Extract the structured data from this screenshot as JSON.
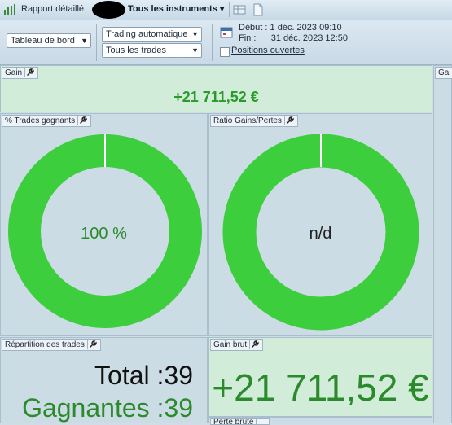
{
  "titlebar": {
    "title": "Rapport détaillé",
    "instruments": "Tous les instruments ▾"
  },
  "toolbar": {
    "view_select": "Tableau de bord",
    "trading_select": "Trading automatique",
    "trades_select": "Tous les trades",
    "debut_label": "Début :",
    "debut_value": "1 déc. 2023 09:10",
    "fin_label": "Fin :",
    "fin_value": "31 déc. 2023 12:50",
    "positions_label": "Positions ouvertes"
  },
  "panels": {
    "gain": {
      "title": "Gain",
      "value": "+21 711,52 €"
    },
    "gain_right": {
      "title": "Gai"
    },
    "pct_winning": {
      "title": "% Trades gagnants",
      "value": "100 %"
    },
    "ratio": {
      "title": "Ratio Gains/Pertes",
      "value": "n/d"
    },
    "repartition": {
      "title": "Répartition des trades",
      "total_label": "Total :",
      "total_value": "39",
      "winning_label": "Gagnantes :",
      "winning_value": "39"
    },
    "gain_brut": {
      "title": "Gain brut",
      "value": "+21 711,52 €"
    },
    "perte_brute": {
      "title": "Perte brute"
    }
  },
  "colors": {
    "donut": "#3dce3d",
    "gain_text": "#2a9a2a"
  }
}
